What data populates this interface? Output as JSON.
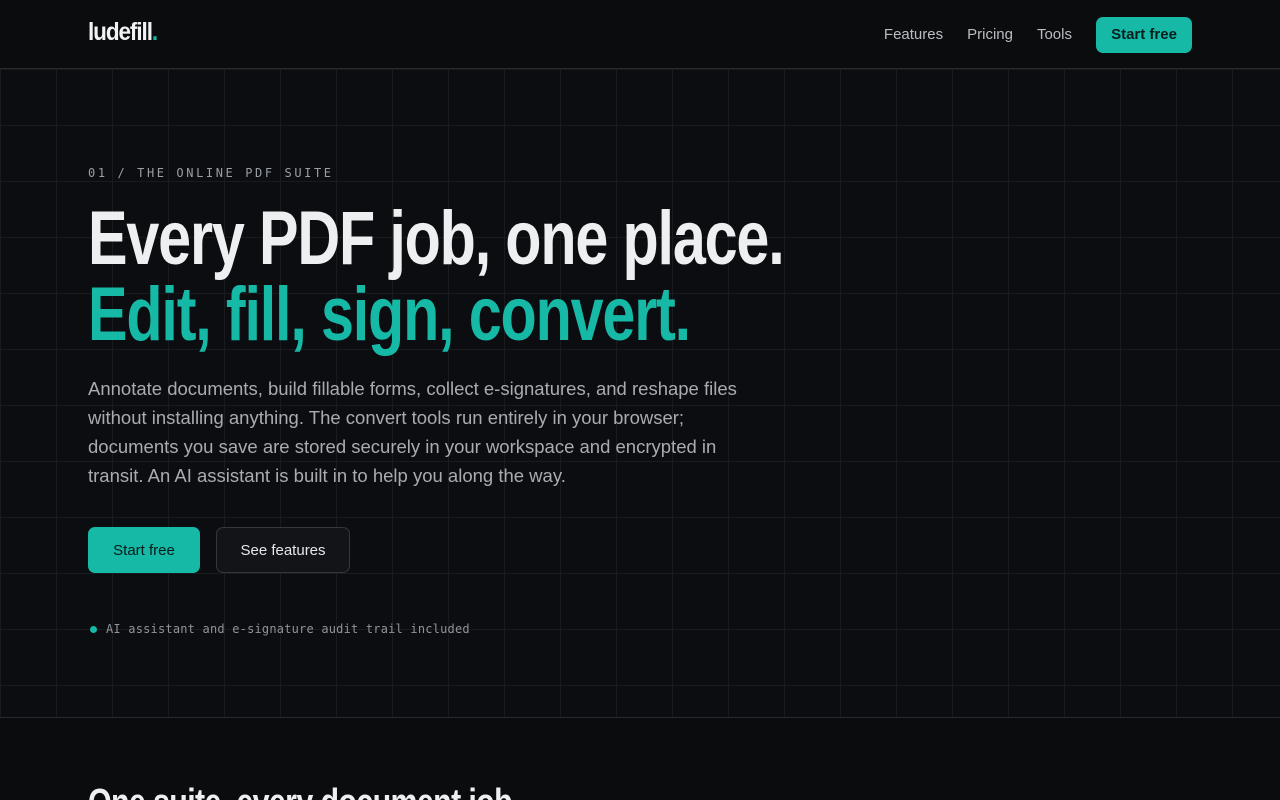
{
  "nav": {
    "logo_text": "ludefill",
    "logo_dot": ".",
    "links": [
      "Features",
      "Pricing",
      "Tools"
    ],
    "cta_label": "Start free"
  },
  "hero": {
    "eyebrow": "01 / THE ONLINE PDF SUITE",
    "headline_line1": "Every PDF job, one place.",
    "headline_line2": "Edit, fill, sign, convert.",
    "lede": "Annotate documents, build fillable forms, collect e-signatures, and reshape files without installing anything. The convert tools run entirely in your browser; documents you save are stored securely in your workspace and encrypted in transit. An AI assistant is built in to help you along the way.",
    "primary_cta": "Start free",
    "secondary_cta": "See features",
    "note": "AI assistant and e-signature audit trail included"
  },
  "section2": {
    "title": "One suite, every document job."
  },
  "colors": {
    "accent": "#16b8a6",
    "background": "#0b0c0e",
    "text": "#eeeff1",
    "muted": "#a8acb2"
  }
}
